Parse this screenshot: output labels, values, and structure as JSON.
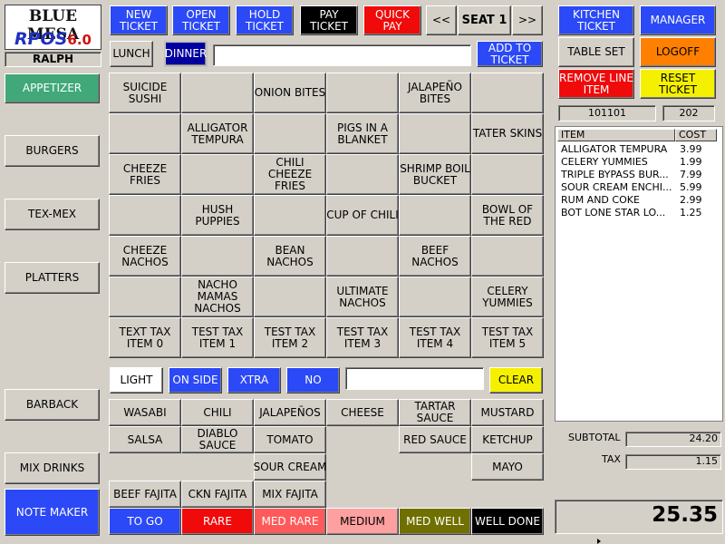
{
  "logo": {
    "line1": "BLUE MESA",
    "line2": "RPOS",
    "version": "6.0"
  },
  "user": "RALPH",
  "top_buttons": {
    "new_ticket": "NEW\nTICKET",
    "open_ticket": "OPEN\nTICKET",
    "hold_ticket": "HOLD\nTICKET",
    "pay_ticket": "PAY\nTICKET",
    "quick_pay": "QUICK PAY",
    "prev": "<<",
    "seat": "SEAT 1",
    "next": ">>"
  },
  "right_buttons": {
    "kitchen_ticket": "KITCHEN\nTICKET",
    "manager": "MANAGER",
    "table_set": "TABLE SET",
    "logoff": "LOGOFF",
    "remove_line_item": "REMOVE LINE\nITEM",
    "reset_ticket": "RESET TICKET"
  },
  "ticket_info": {
    "ticket_number": "101101",
    "table": "202"
  },
  "meal_periods": {
    "lunch": "LUNCH",
    "dinner": "DINNER"
  },
  "add_to_ticket": "ADD TO\nTICKET",
  "categories": [
    "APPETIZER",
    "BURGERS",
    "TEX-MEX",
    "PLATTERS",
    "BARBACK",
    "MIX DRINKS",
    "NOTE MAKER"
  ],
  "menu_items": [
    "SUICIDE\nSUSHI",
    "ONION BITES",
    "JALAPEÑO\nBITES",
    "ALLIGATOR\nTEMPURA",
    "PIGS IN A\nBLANKET",
    "TATER SKINS",
    "CHEEZE\nFRIES",
    "CHILI\nCHEEZE\nFRIES",
    "SHRIMP BOIL\nBUCKET",
    "HUSH\nPUPPIES",
    "CUP OF CHILI",
    "BOWL OF\nTHE RED",
    "CHEEZE\nNACHOS",
    "BEAN\nNACHOS",
    "BEEF\nNACHOS",
    "NACHO\nMAMAS\nNACHOS",
    "ULTIMATE\nNACHOS",
    "CELERY\nYUMMIES",
    "TEXT TAX\nITEM 0",
    "TEST TAX\nITEM 1",
    "TEST TAX\nITEM 2",
    "TEST TAX\nITEM 3",
    "TEST TAX\nITEM 4",
    "TEST TAX\nITEM 5"
  ],
  "modifier_prefixes": {
    "light": "LIGHT",
    "on_side": "ON SIDE",
    "xtra": "XTRA",
    "no": "NO",
    "clear": "CLEAR"
  },
  "modifiers": [
    "WASABI",
    "CHILI",
    "JALAPEÑOS",
    "CHEESE",
    "TARTAR\nSAUCE",
    "MUSTARD",
    "SALSA",
    "DIABLO\nSAUCE",
    "TOMATO",
    "RED SAUCE",
    "KETCHUP",
    "SOUR CREAM",
    "MAYO",
    "BEEF FAJITA",
    "CKN FAJITA",
    "MIX FAJITA"
  ],
  "cook_temps": [
    "TO GO",
    "RARE",
    "MED RARE",
    "MEDIUM",
    "MED WELL",
    "WELL DONE"
  ],
  "order": {
    "col_item": "ITEM",
    "col_cost": "COST",
    "rows": [
      {
        "item": "ALLIGATOR TEMPURA",
        "cost": "3.99"
      },
      {
        "item": "CELERY YUMMIES",
        "cost": "1.99"
      },
      {
        "item": "TRIPLE BYPASS BUR...",
        "cost": "7.99"
      },
      {
        "item": "SOUR CREAM ENCHI...",
        "cost": "5.99"
      },
      {
        "item": "RUM AND COKE",
        "cost": "2.99"
      },
      {
        "item": "BOT LONE STAR LO...",
        "cost": "1.25"
      }
    ]
  },
  "totals": {
    "subtotal_label": "SUBTOTAL",
    "subtotal": "24.20",
    "tax_label": "TAX",
    "tax": "1.15",
    "total": "25.35"
  }
}
